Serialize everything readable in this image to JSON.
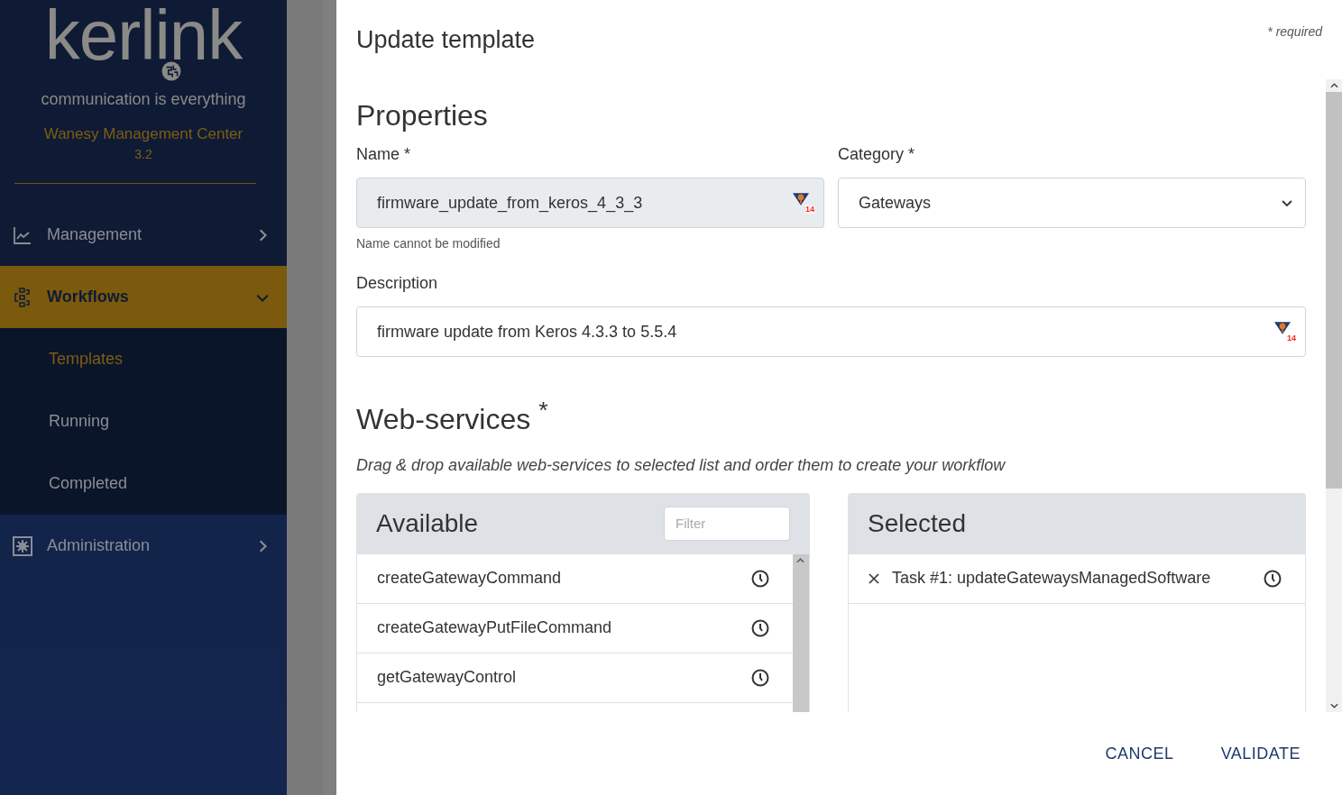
{
  "sidebar": {
    "logo": {
      "wordmark": "kerlink",
      "tagline": "communication is everything"
    },
    "product": "Wanesy Management Center",
    "version": "3.2",
    "nav": [
      {
        "label": "Management",
        "selected": false,
        "expanded": false
      },
      {
        "label": "Workflows",
        "selected": true,
        "expanded": true,
        "children": [
          {
            "label": "Templates",
            "selected": true
          },
          {
            "label": "Running",
            "selected": false
          },
          {
            "label": "Completed",
            "selected": false
          }
        ]
      },
      {
        "label": "Administration",
        "selected": false,
        "expanded": false
      }
    ]
  },
  "modal": {
    "title": "Update template",
    "required_note": "* required",
    "properties_heading": "Properties",
    "name_field": {
      "label": "Name *",
      "value": "firmware_update_from_keros_4_3_3",
      "disabled": true,
      "badge": "14",
      "help": "Name cannot be modified"
    },
    "category_field": {
      "label": "Category *",
      "value": "Gateways"
    },
    "description_field": {
      "label": "Description",
      "value": "firmware update from Keros 4.3.3 to 5.5.4",
      "badge": "14"
    },
    "webservices_heading": "Web-services $^{*}$",
    "hint": "Drag & drop available web-services to selected list and order them to create your workflow",
    "available": {
      "title": "Available",
      "filter_placeholder": "Filter",
      "items": [
        "createGatewayCommand",
        "createGatewayPutFileCommand",
        "getGatewayControl"
      ]
    },
    "selected": {
      "title": "Selected",
      "items": [
        "Task #1: updateGatewaysManagedSoftware"
      ]
    },
    "buttons": [
      {
        "label": "CANCEL"
      },
      {
        "label": "VALIDATE"
      }
    ]
  }
}
